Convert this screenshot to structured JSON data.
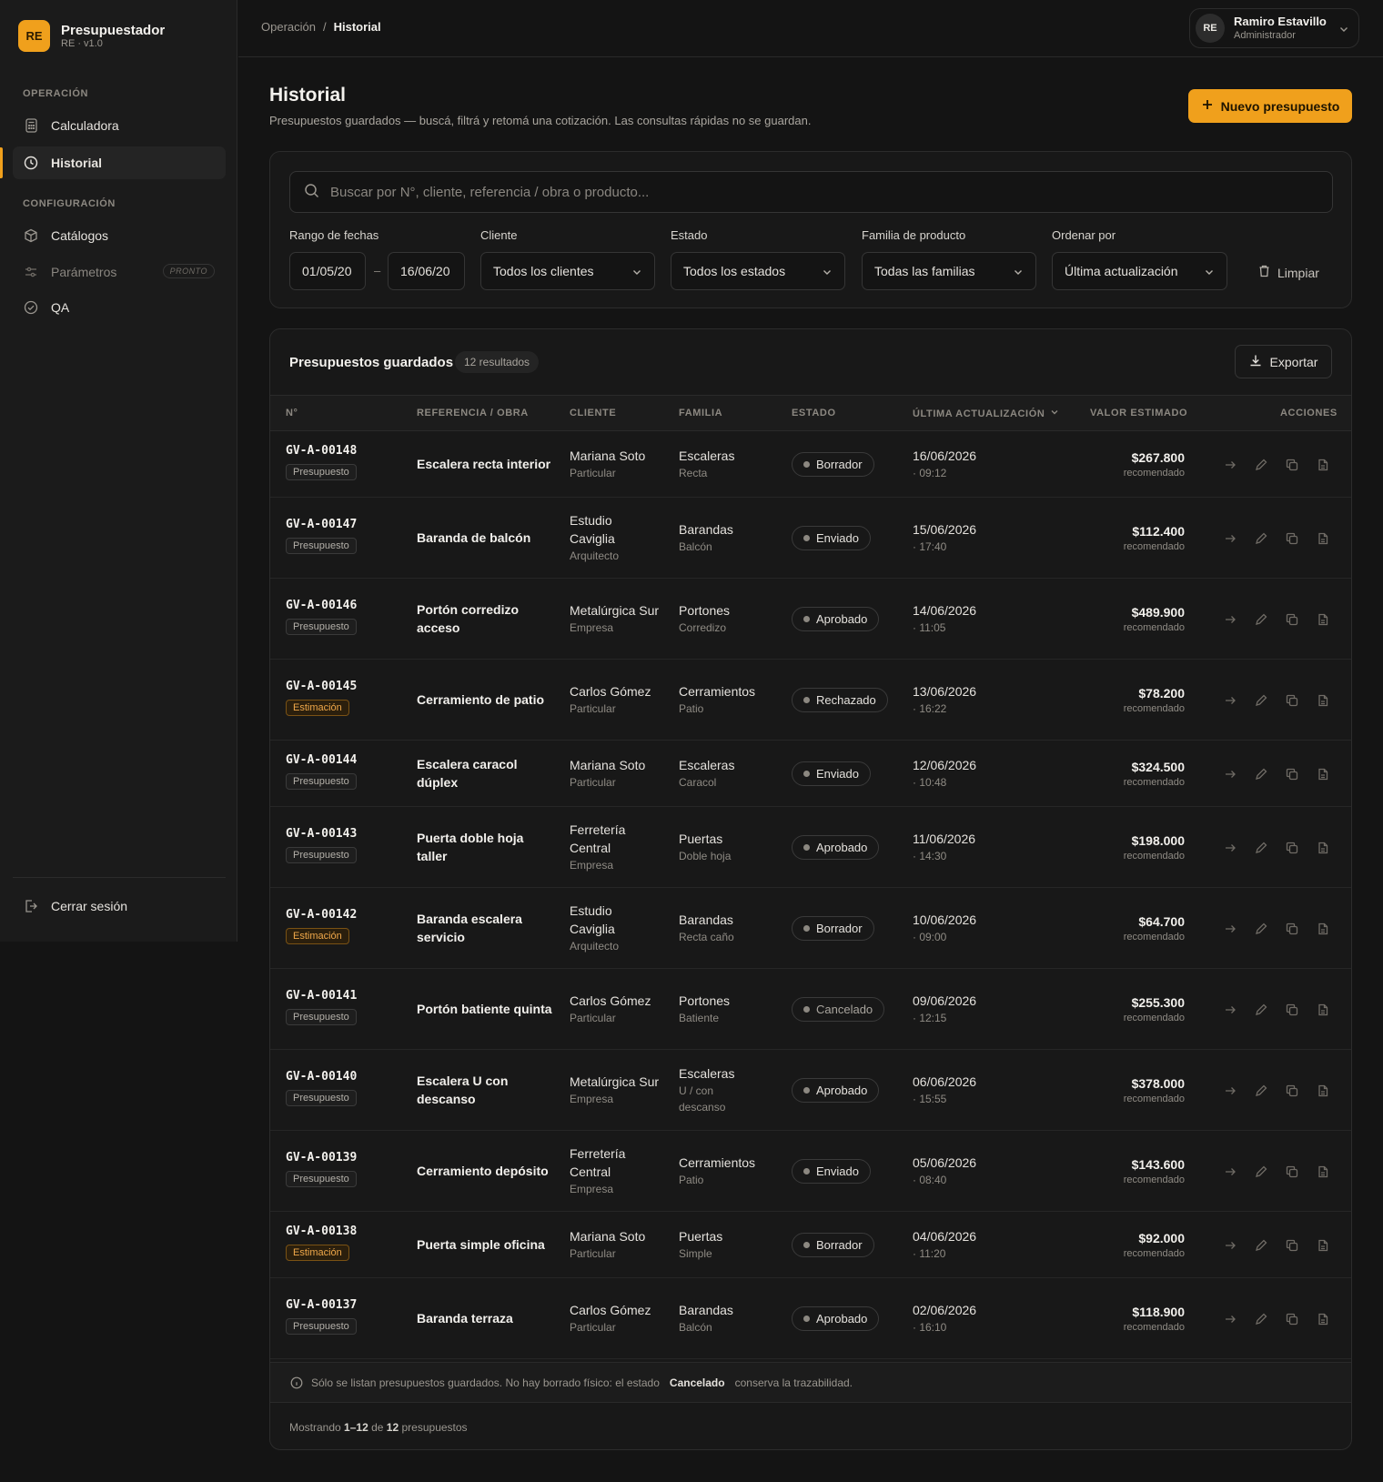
{
  "brand": {
    "logo": "RE",
    "name": "Presupuestador",
    "version": "RE · v1.0"
  },
  "sidebar": {
    "section_operacion": "OPERACIÓN",
    "section_config": "CONFIGURACIÓN",
    "items": [
      {
        "label": "Calculadora",
        "icon": "calculator-icon"
      },
      {
        "label": "Historial",
        "icon": "clock-icon",
        "active": true
      },
      {
        "label": "Catálogos",
        "icon": "box-icon"
      },
      {
        "label": "Parámetros",
        "icon": "sliders-icon",
        "badge": "PRONTO"
      },
      {
        "label": "QA",
        "icon": "check-circle-icon"
      }
    ],
    "logout": "Cerrar sesión"
  },
  "topbar": {
    "breadcrumb_root": "Operación",
    "breadcrumb_sep": "/",
    "breadcrumb_current": "Historial",
    "user_initials": "RE",
    "user_name": "Ramiro Estavillo",
    "user_role": "Administrador"
  },
  "header": {
    "title": "Historial",
    "description": "Presupuestos guardados — buscá, filtrá y retomá una cotización. Las consultas rápidas no se guardan.",
    "new_button": "Nuevo presupuesto"
  },
  "filters": {
    "search_placeholder": "Buscar por N°, cliente, referencia / obra o producto...",
    "date_label": "Rango de fechas",
    "date_from": "01/05/20",
    "date_sep": "–",
    "date_to": "16/06/20",
    "client_label": "Cliente",
    "client_value": "Todos los clientes",
    "status_label": "Estado",
    "status_value": "Todos los estados",
    "family_label": "Familia de producto",
    "family_value": "Todas las familias",
    "order_label": "Ordenar por",
    "order_value": "Última actualización",
    "clear": "Limpiar"
  },
  "table": {
    "title": "Presupuestos guardados",
    "count": "12 resultados",
    "export": "Exportar",
    "columns": [
      "N°",
      "REFERENCIA / OBRA",
      "CLIENTE",
      "FAMILIA",
      "ESTADO",
      "ÚLTIMA ACTUALIZACIÓN",
      "VALOR ESTIMADO",
      "ACCIONES"
    ],
    "rows": [
      {
        "code": "GV-A-00148",
        "kind": "Presupuesto",
        "ref": "Escalera recta interior",
        "client": "Mariana Soto",
        "client_type": "Particular",
        "family": "Escaleras",
        "sub": "Recta",
        "status": "Borrador",
        "date": "16/06/2026",
        "time": "· 09:12",
        "amount": "$267.800",
        "note": "recomendado"
      },
      {
        "code": "GV-A-00147",
        "kind": "Presupuesto",
        "ref": "Baranda de balcón",
        "client": "Estudio Caviglia",
        "client_type": "Arquitecto",
        "family": "Barandas",
        "sub": "Balcón",
        "status": "Enviado",
        "date": "15/06/2026",
        "time": "· 17:40",
        "amount": "$112.400",
        "note": "recomendado"
      },
      {
        "code": "GV-A-00146",
        "kind": "Presupuesto",
        "ref": "Portón corredizo acceso",
        "client": "Metalúrgica Sur",
        "client_type": "Empresa",
        "family": "Portones",
        "sub": "Corredizo",
        "status": "Aprobado",
        "date": "14/06/2026",
        "time": "· 11:05",
        "amount": "$489.900",
        "note": "recomendado"
      },
      {
        "code": "GV-A-00145",
        "kind": "Estimación",
        "ref": "Cerramiento de patio",
        "client": "Carlos Gómez",
        "client_type": "Particular",
        "family": "Cerramientos",
        "sub": "Patio",
        "status": "Rechazado",
        "date": "13/06/2026",
        "time": "· 16:22",
        "amount": "$78.200",
        "note": "recomendado"
      },
      {
        "code": "GV-A-00144",
        "kind": "Presupuesto",
        "ref": "Escalera caracol dúplex",
        "client": "Mariana Soto",
        "client_type": "Particular",
        "family": "Escaleras",
        "sub": "Caracol",
        "status": "Enviado",
        "date": "12/06/2026",
        "time": "· 10:48",
        "amount": "$324.500",
        "note": "recomendado"
      },
      {
        "code": "GV-A-00143",
        "kind": "Presupuesto",
        "ref": "Puerta doble hoja taller",
        "client": "Ferretería Central",
        "client_type": "Empresa",
        "family": "Puertas",
        "sub": "Doble hoja",
        "status": "Aprobado",
        "date": "11/06/2026",
        "time": "· 14:30",
        "amount": "$198.000",
        "note": "recomendado"
      },
      {
        "code": "GV-A-00142",
        "kind": "Estimación",
        "ref": "Baranda escalera servicio",
        "client": "Estudio Caviglia",
        "client_type": "Arquitecto",
        "family": "Barandas",
        "sub": "Recta caño",
        "status": "Borrador",
        "date": "10/06/2026",
        "time": "· 09:00",
        "amount": "$64.700",
        "note": "recomendado"
      },
      {
        "code": "GV-A-00141",
        "kind": "Presupuesto",
        "ref": "Portón batiente quinta",
        "client": "Carlos Gómez",
        "client_type": "Particular",
        "family": "Portones",
        "sub": "Batiente",
        "status": "Cancelado",
        "date": "09/06/2026",
        "time": "· 12:15",
        "amount": "$255.300",
        "note": "recomendado"
      },
      {
        "code": "GV-A-00140",
        "kind": "Presupuesto",
        "ref": "Escalera U con descanso",
        "client": "Metalúrgica Sur",
        "client_type": "Empresa",
        "family": "Escaleras",
        "sub": "U / con descanso",
        "status": "Aprobado",
        "date": "06/06/2026",
        "time": "· 15:55",
        "amount": "$378.000",
        "note": "recomendado"
      },
      {
        "code": "GV-A-00139",
        "kind": "Presupuesto",
        "ref": "Cerramiento depósito",
        "client": "Ferretería Central",
        "client_type": "Empresa",
        "family": "Cerramientos",
        "sub": "Patio",
        "status": "Enviado",
        "date": "05/06/2026",
        "time": "· 08:40",
        "amount": "$143.600",
        "note": "recomendado"
      },
      {
        "code": "GV-A-00138",
        "kind": "Estimación",
        "ref": "Puerta simple oficina",
        "client": "Mariana Soto",
        "client_type": "Particular",
        "family": "Puertas",
        "sub": "Simple",
        "status": "Borrador",
        "date": "04/06/2026",
        "time": "· 11:20",
        "amount": "$92.000",
        "note": "recomendado"
      },
      {
        "code": "GV-A-00137",
        "kind": "Presupuesto",
        "ref": "Baranda terraza",
        "client": "Carlos Gómez",
        "client_type": "Particular",
        "family": "Barandas",
        "sub": "Balcón",
        "status": "Aprobado",
        "date": "02/06/2026",
        "time": "· 16:10",
        "amount": "$118.900",
        "note": "recomendado"
      }
    ],
    "notice_pre": "Sólo se listan presupuestos guardados. No hay borrado físico: el estado",
    "notice_bold": "Cancelado",
    "notice_post": "conserva la trazabilidad.",
    "footer_pre": "Mostrando",
    "footer_range": "1–12",
    "footer_mid": "de",
    "footer_total": "12",
    "footer_post": "presupuestos"
  },
  "colors": {
    "accent": "#f0a01c",
    "background": "#141414",
    "surface": "#181818"
  }
}
